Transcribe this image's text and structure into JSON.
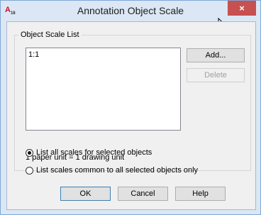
{
  "window": {
    "title": "Annotation Object Scale",
    "close_glyph": "×",
    "app_icon": "autocad-icon",
    "app_icon_text": "A",
    "app_icon_sub": "18"
  },
  "group": {
    "label": "Object Scale List",
    "list_items": [
      "1:1"
    ]
  },
  "buttons": {
    "add": "Add...",
    "delete": "Delete",
    "ok": "OK",
    "cancel": "Cancel",
    "help": "Help"
  },
  "unit_text": "1 paper unit = 1 drawing unit",
  "options": {
    "list_all": "List all scales for selected objects",
    "list_common": "List scales common to all selected objects only",
    "selected": "list_all"
  }
}
